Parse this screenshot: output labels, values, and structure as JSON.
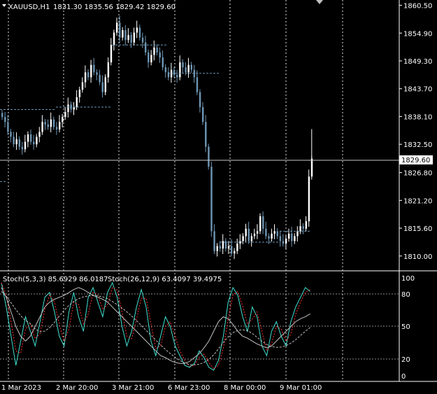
{
  "header": {
    "symbol": "XAUUSD,H1",
    "ohlc": "1831.30 1835.56 1829.42 1829.60"
  },
  "price_axis": {
    "labels": [
      "1860.50",
      "1854.90",
      "1849.30",
      "1843.70",
      "1838.10",
      "1832.50",
      "1826.80",
      "1821.20",
      "1815.60",
      "1810.00"
    ],
    "current_price": "1829.60"
  },
  "stoch_panel": {
    "legend_1": "Stoch(5,3,3) 85.6929 86.0187",
    "legend_2": "Stoch(26,12,9) 63.4097 39.4975",
    "levels": [
      "100",
      "80",
      "50",
      "20",
      "0"
    ]
  },
  "time_axis": {
    "labels": [
      "1 Mar 2023",
      "2 Mar 20:00",
      "3 Mar 21:00",
      "6 Mar 23:00",
      "8 Mar 00:00",
      "9 Mar 01:00"
    ]
  },
  "colors": {
    "background": "#000000",
    "bull_candle": "#ffffff",
    "bear_candle": "#6e96b4",
    "grid": "#ffffff",
    "stoch_main": "#40e0d0",
    "stoch_signal": "#ff3030",
    "stoch_slow": "#c0c0c0"
  },
  "chart_data": [
    {
      "type": "candlestick",
      "symbol": "XAUUSD",
      "timeframe": "H1",
      "ylim": [
        1808.0,
        1861.0
      ],
      "close": [
        1838.0,
        1837.0,
        1835.0,
        1834.0,
        1832.5,
        1833.5,
        1832.0,
        1831.5,
        1833.0,
        1834.5,
        1833.0,
        1832.5,
        1834.0,
        1835.0,
        1837.0,
        1836.5,
        1836.0,
        1837.5,
        1836.0,
        1835.5,
        1837.0,
        1838.0,
        1839.0,
        1840.5,
        1839.5,
        1840.0,
        1842.0,
        1843.5,
        1845.0,
        1847.0,
        1846.0,
        1848.5,
        1847.0,
        1846.5,
        1845.0,
        1843.0,
        1846.0,
        1849.0,
        1852.5,
        1855.0,
        1857.0,
        1854.0,
        1855.5,
        1853.5,
        1854.5,
        1853.0,
        1855.0,
        1856.0,
        1854.0,
        1853.0,
        1851.0,
        1849.0,
        1850.5,
        1852.0,
        1851.0,
        1850.0,
        1848.0,
        1847.0,
        1846.0,
        1847.5,
        1846.5,
        1846.0,
        1849.0,
        1848.0,
        1847.0,
        1848.5,
        1847.5,
        1846.0,
        1843.0,
        1840.0,
        1837.0,
        1832.0,
        1828.0,
        1815.0,
        1811.0,
        1812.0,
        1811.5,
        1813.0,
        1811.5,
        1812.0,
        1810.5,
        1811.0,
        1812.5,
        1813.0,
        1814.0,
        1815.5,
        1813.0,
        1814.0,
        1814.5,
        1815.0,
        1818.0,
        1815.5,
        1814.0,
        1813.5,
        1814.5,
        1815.0,
        1814.0,
        1813.0,
        1812.5,
        1813.5,
        1814.5,
        1813.0,
        1814.0,
        1815.0,
        1816.0,
        1815.5,
        1817.0,
        1826.0,
        1829.6
      ],
      "timeframe_labels": [
        "1 Mar 2023",
        "2 Mar 20:00",
        "3 Mar 21:00",
        "6 Mar 23:00",
        "8 Mar 00:00",
        "9 Mar 01:00"
      ],
      "current_price": 1829.6
    },
    {
      "type": "line",
      "name": "Stochastic",
      "ylim": [
        0,
        100
      ],
      "levels": [
        20,
        50,
        80
      ],
      "series": [
        {
          "name": "Stoch(5,3,3) main",
          "last": 85.6929
        },
        {
          "name": "Stoch(5,3,3) signal",
          "last": 86.0187
        },
        {
          "name": "Stoch(26,12,9) main",
          "last": 63.4097
        },
        {
          "name": "Stoch(26,12,9) signal",
          "last": 39.4975
        }
      ]
    }
  ]
}
